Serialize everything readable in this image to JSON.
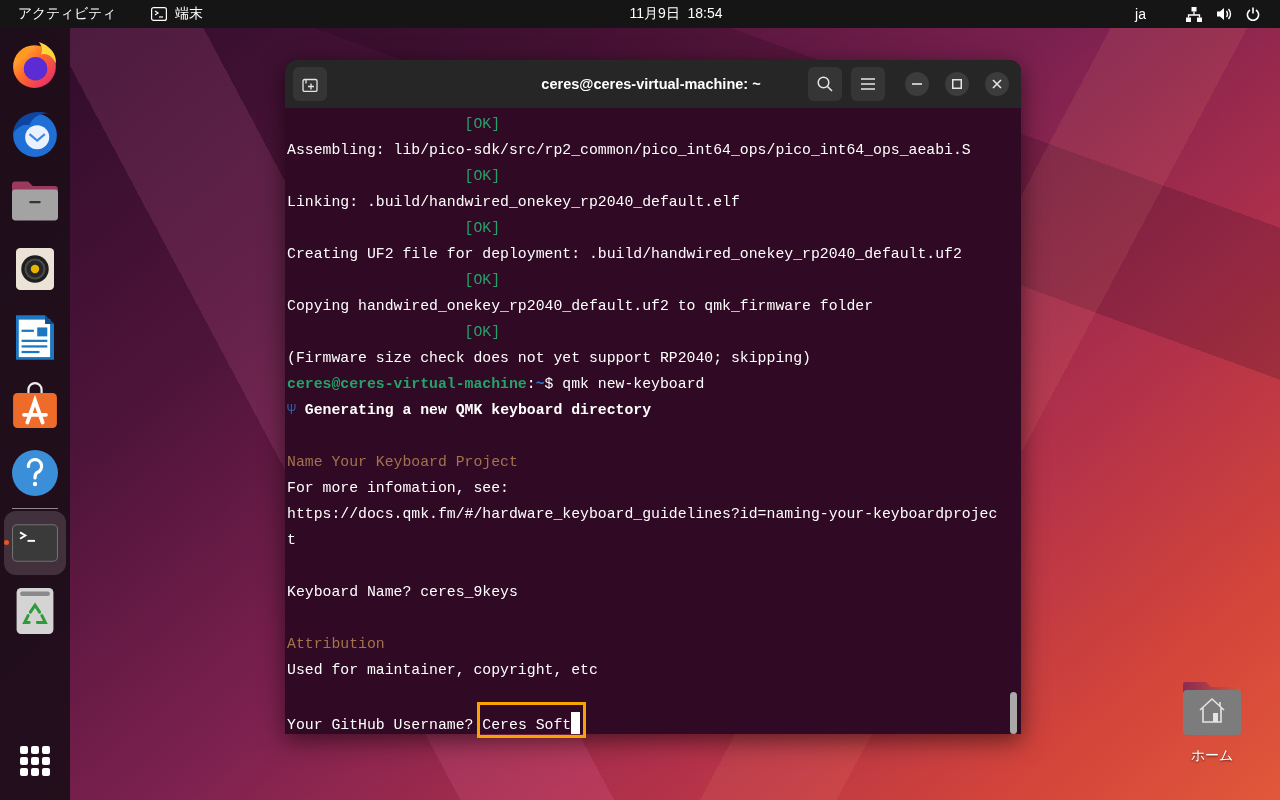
{
  "top_bar": {
    "activities": "アクティビティ",
    "app_menu": "端末",
    "clock": "11月9日  18:54",
    "input_method": "ja"
  },
  "dock": {
    "pinned": [
      {
        "running": false,
        "selected": false
      },
      {
        "running": false,
        "selected": false
      },
      {
        "running": false,
        "selected": false
      },
      {
        "running": false,
        "selected": false
      },
      {
        "running": false,
        "selected": false
      },
      {
        "running": false,
        "selected": false
      },
      {
        "running": false,
        "selected": false
      }
    ],
    "others": [
      {
        "running": true,
        "selected": true
      },
      {
        "running": false,
        "selected": false
      }
    ]
  },
  "window": {
    "title": "ceres@ceres-virtual-machine: ~"
  },
  "terminal": {
    "lines": [
      {
        "kind": "ok",
        "text": "[OK]"
      },
      {
        "kind": "output",
        "text": "Assembling: lib/pico-sdk/src/rp2_common/pico_int64_ops/pico_int64_ops_aeabi.S"
      },
      {
        "kind": "ok",
        "text": "[OK]"
      },
      {
        "kind": "output",
        "text": "Linking: .build/handwired_onekey_rp2040_default.elf"
      },
      {
        "kind": "ok",
        "text": "[OK]"
      },
      {
        "kind": "output",
        "text": "Creating UF2 file for deployment: .build/handwired_onekey_rp2040_default.uf2"
      },
      {
        "kind": "ok",
        "text": "[OK]"
      },
      {
        "kind": "output",
        "text": "Copying handwired_onekey_rp2040_default.uf2 to qmk_firmware folder"
      },
      {
        "kind": "ok",
        "text": "[OK]"
      },
      {
        "kind": "output",
        "text": "(Firmware size check does not yet support RP2040; skipping)"
      },
      {
        "kind": "prompt",
        "user_host": "ceres@ceres-virtual-machine",
        "separator": ":",
        "path": "~",
        "symbol": "$",
        "command": "qmk new-keyboard"
      },
      {
        "kind": "status",
        "icon": "Ψ",
        "text": "Generating a new QMK keyboard directory"
      },
      {
        "kind": "blank"
      },
      {
        "kind": "heading",
        "text": "Name Your Keyboard Project"
      },
      {
        "kind": "output",
        "text": "For more infomation, see:"
      },
      {
        "kind": "output",
        "text": "https://docs.qmk.fm/#/hardware_keyboard_guidelines?id=naming-your-keyboardproject"
      },
      {
        "kind": "blank"
      },
      {
        "kind": "answer",
        "prompt": "Keyboard Name?",
        "answer": "ceres_9keys",
        "highlighted": false,
        "cursor": false
      },
      {
        "kind": "blank"
      },
      {
        "kind": "heading",
        "text": "Attribution"
      },
      {
        "kind": "output",
        "text": "Used for maintainer, copyright, etc"
      },
      {
        "kind": "blank"
      },
      {
        "kind": "answer",
        "prompt": "Your GitHub Username?",
        "answer": "Ceres Soft",
        "highlighted": true,
        "cursor": true
      }
    ]
  },
  "desktop_icons": [
    {
      "label": "ホーム"
    }
  ]
}
